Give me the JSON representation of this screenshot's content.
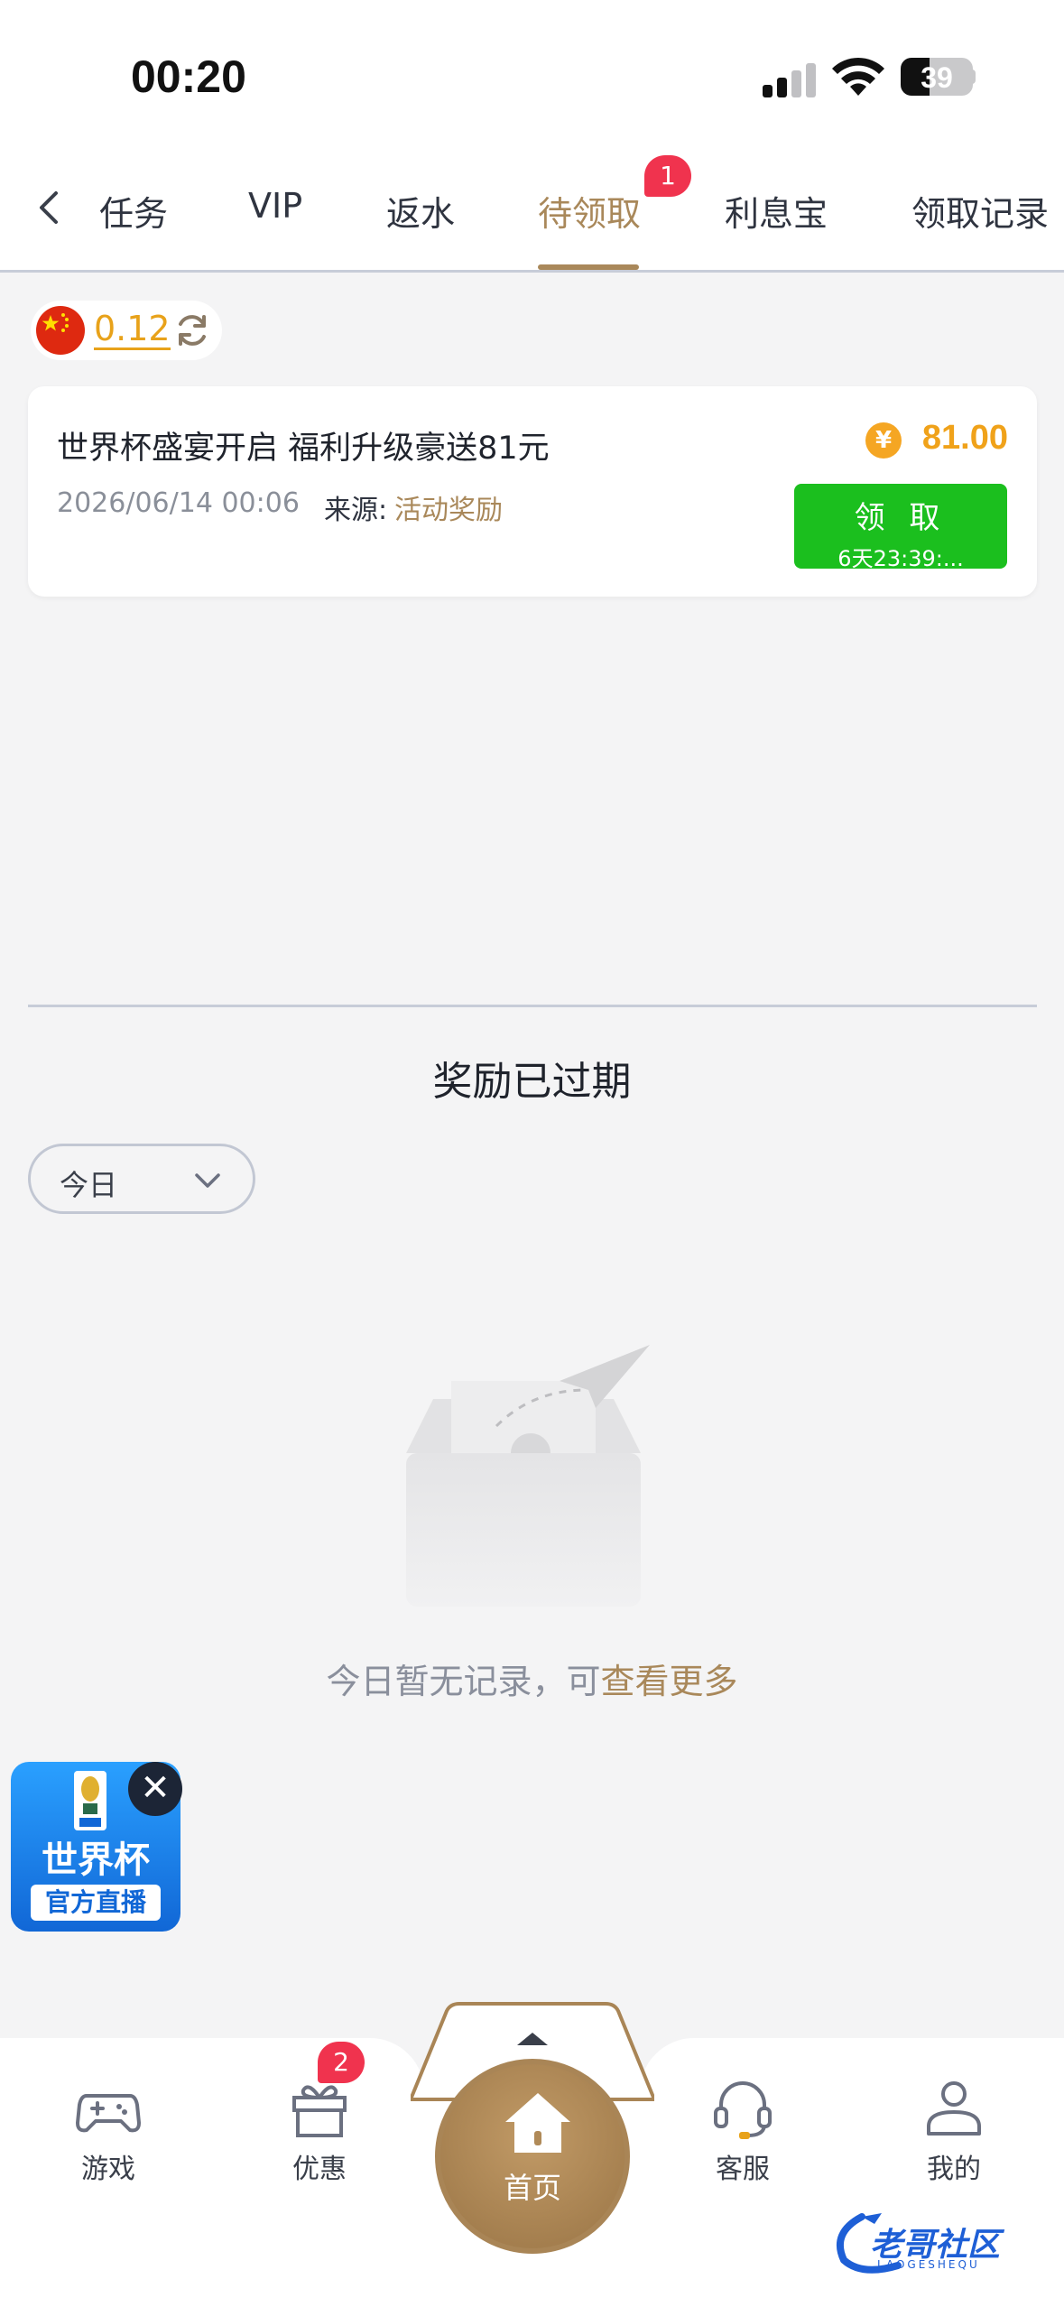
{
  "status_bar": {
    "time": "00:20",
    "battery": "39"
  },
  "tabs": {
    "items": [
      "任务",
      "VIP",
      "返水",
      "待领取",
      "利息宝",
      "领取记录"
    ],
    "active_index": 3,
    "badge": "1"
  },
  "balance": {
    "value": "0.12"
  },
  "reward": {
    "title": "世界杯盛宴开启 福利升级豪送81元",
    "amount": "81.00",
    "coin_symbol": "¥",
    "date": "2026/06/14 00:06",
    "source_label": "来源:",
    "source": "活动奖励",
    "claim_label": "领 取",
    "countdown": "6天23:39:..."
  },
  "expired": {
    "title": "奖励已过期",
    "filter": "今日",
    "empty_text": "今日暂无记录，可",
    "empty_link": "查看更多"
  },
  "floating": {
    "title": "世界杯",
    "subtitle": "官方直播",
    "close": "✕"
  },
  "bottom_nav": {
    "items": [
      {
        "label": "游戏",
        "icon": "gamepad-icon"
      },
      {
        "label": "优惠",
        "icon": "gift-icon"
      },
      {
        "label": "首页",
        "icon": "home-icon"
      },
      {
        "label": "客服",
        "icon": "headset-icon"
      },
      {
        "label": "我的",
        "icon": "user-icon"
      }
    ],
    "promo_badge": "2"
  },
  "watermark": {
    "text": "老哥社区",
    "sub": "LAOGESHEQU"
  },
  "colors": {
    "accent": "#a9885a",
    "claim": "#1bbf1e",
    "amount": "#f0a21a",
    "badge": "#f0334e"
  }
}
